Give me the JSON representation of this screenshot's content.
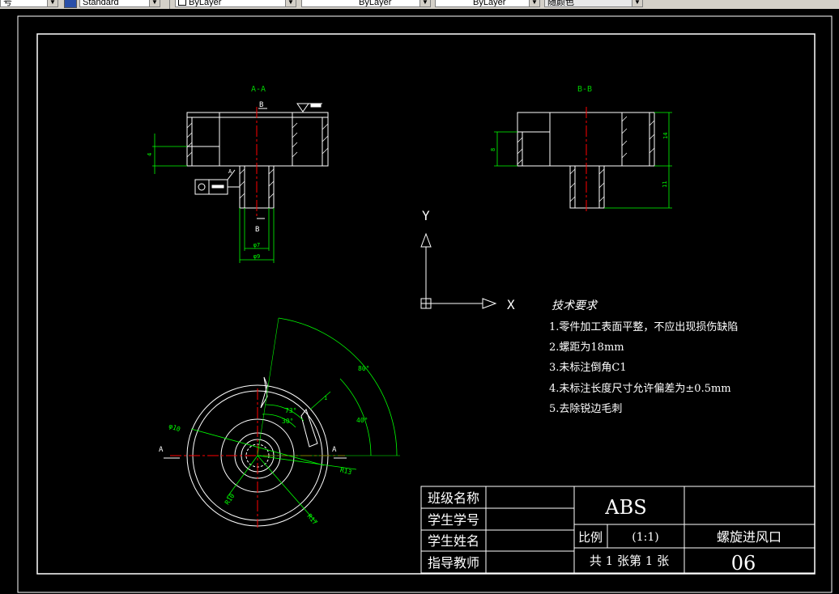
{
  "toolbar": {
    "item0": "号",
    "textstyle": "Standard",
    "layer": "ByLayer",
    "linetype": "ByLayer",
    "lineweight": "ByLayer",
    "plotstyle": "随颜色"
  },
  "colors": {
    "background": "#000000",
    "lines": "#ffffff",
    "center": "#ff0000",
    "dimension": "#00ff00",
    "label": "#00cc00"
  },
  "drawing": {
    "view_aa": {
      "title": "A-A",
      "cut_label": "B",
      "cut_label_bottom": "B",
      "dims": {
        "phi7": "φ7",
        "phi9": "φ9",
        "height": "4",
        "datum": "A"
      }
    },
    "view_bb": {
      "title": "B-B",
      "dims": {
        "left": "8",
        "right_top": "14",
        "right_bottom": "11"
      }
    },
    "ucs": {
      "y_label": "Y",
      "x_label": "X"
    },
    "plan_view": {
      "section_left": "A",
      "section_right": "A",
      "dims": {
        "a80": "80°",
        "a40": "40°",
        "a73": "73°",
        "a30": "30°",
        "r10": "R10",
        "r13": "R13",
        "r15": "R15",
        "r17": "R17",
        "phi10": "φ10",
        "small": "1"
      }
    },
    "requirements": {
      "title": "技术要求",
      "items": [
        "1.零件加工表面平整，不应出现损伤缺陷",
        "2.螺距为18mm",
        "3.未标注倒角C1",
        "4.未标注长度尺寸允许偏差为±0.5mm",
        "5.去除锐边毛刺"
      ]
    },
    "title_block": {
      "class_label": "班级名称",
      "student_id_label": "学生学号",
      "student_name_label": "学生姓名",
      "teacher_label": "指导教师",
      "material": "ABS",
      "scale_label": "比例",
      "scale_value": "(1:1)",
      "sheets": "共 1 张第 1 张",
      "part_name": "螺旋进风口",
      "drawing_no": "06"
    }
  }
}
